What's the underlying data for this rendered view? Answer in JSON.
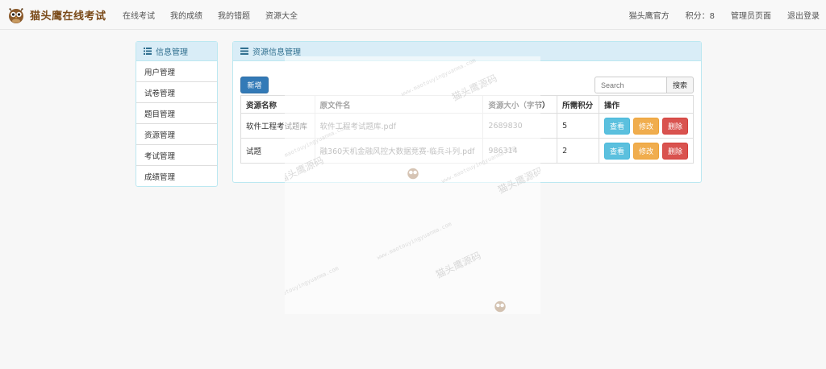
{
  "brand": {
    "name": "猫头鹰在线考试"
  },
  "nav": {
    "left": [
      "在线考试",
      "我的成绩",
      "我的错题",
      "资源大全"
    ],
    "official": "猫头鹰官方",
    "score": "积分：8",
    "admin": "管理员页面",
    "logout": "退出登录"
  },
  "sidebar": {
    "title": "信息管理",
    "items": [
      "用户管理",
      "试卷管理",
      "题目管理",
      "资源管理",
      "考试管理",
      "成绩管理"
    ]
  },
  "main": {
    "title": "资源信息管理",
    "add_label": "新增",
    "search_placeholder": "Search",
    "search_label": "搜索",
    "columns": [
      "资源名称",
      "原文件名",
      "资源大小（字节）",
      "所需积分",
      "操作"
    ],
    "rows": [
      {
        "name": "软件工程考试题库",
        "file": "软件工程考试题库.pdf",
        "size": "2689830",
        "points": "5"
      },
      {
        "name": "试题",
        "file": "融360天机金融风控大数据竞赛-临兵斗列.pdf",
        "size": "986314",
        "points": "2"
      }
    ],
    "actions": {
      "view": "查看",
      "edit": "修改",
      "delete": "删除"
    }
  },
  "watermark": {
    "text": "猫头鹰源码",
    "url": "www.maotouyingyuanma.com"
  },
  "colors": {
    "primary": "#337ab7",
    "info": "#5bc0de",
    "warning": "#f0ad4e",
    "danger": "#d9534f",
    "panel_head": "#d9edf7",
    "brand": "#7a4a19"
  }
}
